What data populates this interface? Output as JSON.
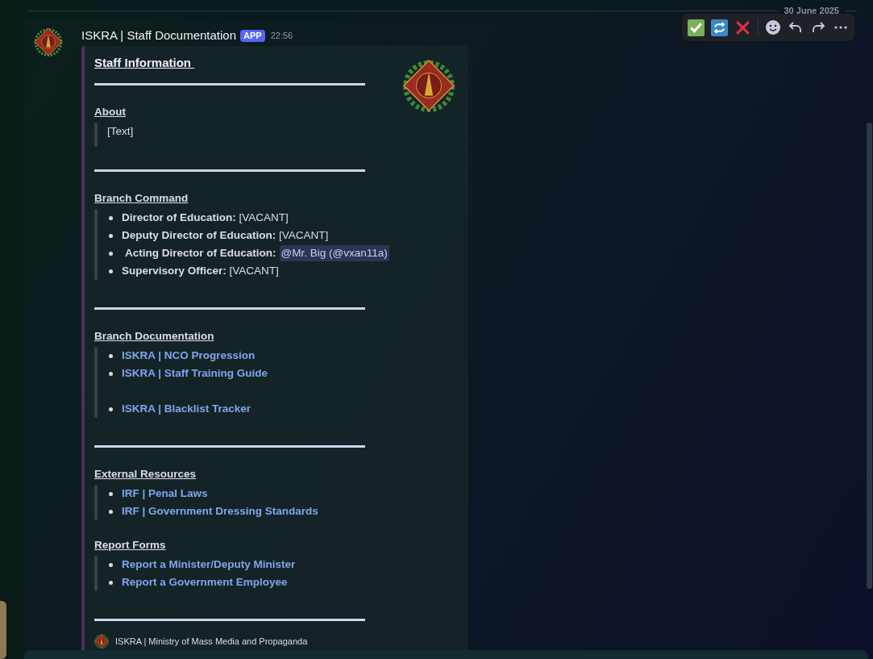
{
  "date_divider": "30 June 2025",
  "message": {
    "author": "ISKRA | Staff Documentation",
    "badge": "APP",
    "time": "22:56"
  },
  "toolbar": [
    {
      "kind": "check"
    },
    {
      "kind": "repeat"
    },
    {
      "kind": "cross"
    },
    {
      "kind": "emoji"
    },
    {
      "kind": "reply"
    },
    {
      "kind": "forward"
    },
    {
      "kind": "more"
    }
  ],
  "embed": {
    "title": "Staff Information ",
    "blocks": [
      {
        "kind": "rule"
      },
      {
        "kind": "heading",
        "text": "About"
      },
      {
        "kind": "quote",
        "text": "[Text]"
      },
      {
        "kind": "rule"
      },
      {
        "kind": "heading",
        "text": "Branch Command"
      },
      {
        "kind": "list",
        "items": [
          {
            "kind": "field",
            "label": "Director of Education:",
            "value": "[VACANT]"
          },
          {
            "kind": "field",
            "label": "Deputy Director of Education:",
            "value": "[VACANT]"
          },
          {
            "kind": "mention",
            "label": "Acting Director of Education:",
            "value": "@Mr. Big (@vxan11a)"
          },
          {
            "kind": "field",
            "label": "Supervisory Officer:",
            "value": "[VACANT]"
          }
        ]
      },
      {
        "kind": "rule"
      },
      {
        "kind": "heading",
        "text": "Branch Documentation"
      },
      {
        "kind": "list",
        "items": [
          {
            "kind": "link",
            "value": "ISKRA | NCO Progression"
          },
          {
            "kind": "link",
            "value": "ISKRA | Staff Training Guide"
          },
          {
            "kind": "blank"
          },
          {
            "kind": "link",
            "value": "ISKRA | Blacklist Tracker"
          }
        ]
      },
      {
        "kind": "rule"
      },
      {
        "kind": "heading",
        "text": "External Resources"
      },
      {
        "kind": "list",
        "items": [
          {
            "kind": "link",
            "value": "IRF | Penal Laws"
          },
          {
            "kind": "link",
            "value": "IRF | Government Dressing Standards"
          }
        ]
      },
      {
        "kind": "heading",
        "text": "Report Forms"
      },
      {
        "kind": "list",
        "items": [
          {
            "kind": "link",
            "value": "Report a Minister/Deputy Minister"
          },
          {
            "kind": "link",
            "value": "Report a Government Employee"
          }
        ]
      },
      {
        "kind": "rule"
      }
    ],
    "footer": "ISKRA | Ministry of Mass Media and Propaganda"
  }
}
